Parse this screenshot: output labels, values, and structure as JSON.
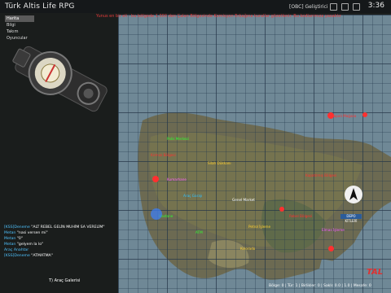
{
  "app": {
    "title": "Türk Altis Life RPG",
    "clock": "3:36",
    "server_tag": "[OBC] Geliştirici"
  },
  "ticker": "Yunus en bir eli - bu bölgede 1.000 den Çalan Bölgesinde Komisyon Erbağına kurallar gözetlenir. Bu kodlarımıza yasaktır",
  "menu": {
    "items": [
      "Harita",
      "Bilgi",
      "Takım",
      "Oyuncular"
    ],
    "selected": 0
  },
  "chat": [
    {
      "name": "[KSS]Deneme",
      "text": "ALT REBEL GELİN MUHİM SA VERELİM"
    },
    {
      "name": "Metan",
      "text": "nasi versen mi"
    },
    {
      "name": "Metan",
      "text": "0"
    },
    {
      "name": "Metan",
      "text": "gelyem la lo"
    },
    {
      "name": "Araç Anahtar",
      "text": ""
    },
    {
      "name": "[KSS]Deneme",
      "text": "ATMATMA"
    }
  ],
  "garage_label": "T) Araç Galerisi",
  "status_line": "Bölge: 0 | Tür: 1 | Birlikler: 0 | Saklı: 0.0 | 1.0 | Mesafe: 0",
  "map_tag": "DEPO KİTLERİ",
  "brand": "TAL",
  "labels": [
    {
      "t": "Kapalı Mağaza",
      "c": "#ff3030"
    },
    {
      "t": "Polis Merkezi",
      "c": "#30ff30"
    },
    {
      "t": "Kırmızı Bölgesi",
      "c": "#ff3030"
    },
    {
      "t": "Silah Dükkanı",
      "c": "#ffd030"
    },
    {
      "t": "Kapatılmış Bölgesi",
      "c": "#ff3030"
    },
    {
      "t": "Kumarhane",
      "c": "#ff60ff"
    },
    {
      "t": "Araç Garajı",
      "c": "#30c0ff"
    },
    {
      "t": "Genel Market",
      "c": "#ffffff"
    },
    {
      "t": "Hastane",
      "c": "#30ff30"
    },
    {
      "t": "Petrol İşleme",
      "c": "#ffd030"
    },
    {
      "t": "Rebel Bölgesi",
      "c": "#ff3030"
    },
    {
      "t": "ATM",
      "c": "#30ff30"
    },
    {
      "t": "Kolorado",
      "c": "#ffd030"
    },
    {
      "t": "Elmas İşleme",
      "c": "#ff60ff"
    }
  ]
}
